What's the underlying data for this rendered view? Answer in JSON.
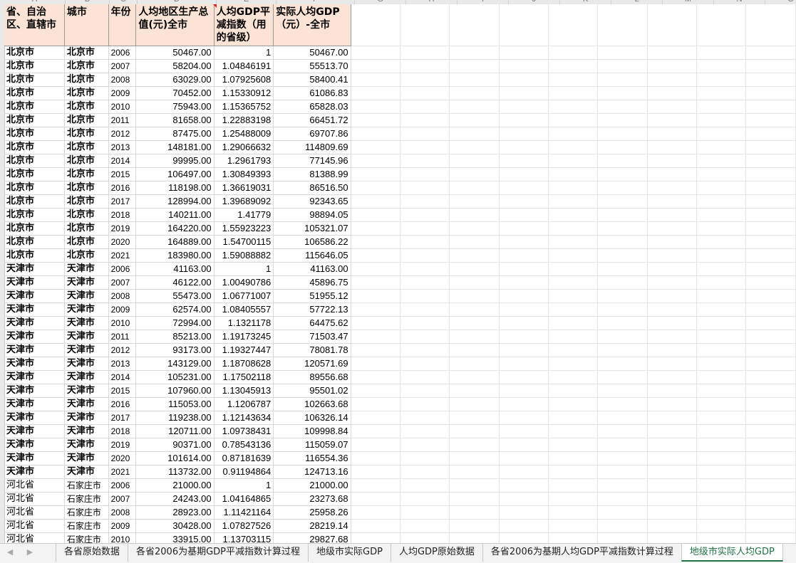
{
  "column_letters": [
    "A",
    "B",
    "C",
    "D",
    "E",
    "F",
    "G",
    "H",
    "I",
    "J",
    "K",
    "L",
    "M",
    "N",
    "O"
  ],
  "headers": {
    "province": "省、自治区、直辖市",
    "city": "城市",
    "year": "年份",
    "gdp_per_capita": "人均地区生产总值(元)全市",
    "deflator": "人均GDP平减指数（用的省级）",
    "real_gdp": "实际人均GDP（元）-全市"
  },
  "rows": [
    {
      "province": "北京市",
      "city": "北京市",
      "year": "2006",
      "gdp": "50467.00",
      "deflator": "1",
      "real": "50467.00"
    },
    {
      "province": "北京市",
      "city": "北京市",
      "year": "2007",
      "gdp": "58204.00",
      "deflator": "1.04846191",
      "real": "55513.70"
    },
    {
      "province": "北京市",
      "city": "北京市",
      "year": "2008",
      "gdp": "63029.00",
      "deflator": "1.07925608",
      "real": "58400.41"
    },
    {
      "province": "北京市",
      "city": "北京市",
      "year": "2009",
      "gdp": "70452.00",
      "deflator": "1.15330912",
      "real": "61086.83"
    },
    {
      "province": "北京市",
      "city": "北京市",
      "year": "2010",
      "gdp": "75943.00",
      "deflator": "1.15365752",
      "real": "65828.03"
    },
    {
      "province": "北京市",
      "city": "北京市",
      "year": "2011",
      "gdp": "81658.00",
      "deflator": "1.22883198",
      "real": "66451.72"
    },
    {
      "province": "北京市",
      "city": "北京市",
      "year": "2012",
      "gdp": "87475.00",
      "deflator": "1.25488009",
      "real": "69707.86"
    },
    {
      "province": "北京市",
      "city": "北京市",
      "year": "2013",
      "gdp": "148181.00",
      "deflator": "1.29066632",
      "real": "114809.69"
    },
    {
      "province": "北京市",
      "city": "北京市",
      "year": "2014",
      "gdp": "99995.00",
      "deflator": "1.2961793",
      "real": "77145.96"
    },
    {
      "province": "北京市",
      "city": "北京市",
      "year": "2015",
      "gdp": "106497.00",
      "deflator": "1.30849393",
      "real": "81388.99"
    },
    {
      "province": "北京市",
      "city": "北京市",
      "year": "2016",
      "gdp": "118198.00",
      "deflator": "1.36619031",
      "real": "86516.50"
    },
    {
      "province": "北京市",
      "city": "北京市",
      "year": "2017",
      "gdp": "128994.00",
      "deflator": "1.39689092",
      "real": "92343.65"
    },
    {
      "province": "北京市",
      "city": "北京市",
      "year": "2018",
      "gdp": "140211.00",
      "deflator": "1.41779",
      "real": "98894.05"
    },
    {
      "province": "北京市",
      "city": "北京市",
      "year": "2019",
      "gdp": "164220.00",
      "deflator": "1.55923223",
      "real": "105321.07"
    },
    {
      "province": "北京市",
      "city": "北京市",
      "year": "2020",
      "gdp": "164889.00",
      "deflator": "1.54700115",
      "real": "106586.22"
    },
    {
      "province": "北京市",
      "city": "北京市",
      "year": "2021",
      "gdp": "183980.00",
      "deflator": "1.59088882",
      "real": "115646.05"
    },
    {
      "province": "天津市",
      "city": "天津市",
      "year": "2006",
      "gdp": "41163.00",
      "deflator": "1",
      "real": "41163.00"
    },
    {
      "province": "天津市",
      "city": "天津市",
      "year": "2007",
      "gdp": "46122.00",
      "deflator": "1.00490786",
      "real": "45896.75"
    },
    {
      "province": "天津市",
      "city": "天津市",
      "year": "2008",
      "gdp": "55473.00",
      "deflator": "1.06771007",
      "real": "51955.12"
    },
    {
      "province": "天津市",
      "city": "天津市",
      "year": "2009",
      "gdp": "62574.00",
      "deflator": "1.08405557",
      "real": "57722.13"
    },
    {
      "province": "天津市",
      "city": "天津市",
      "year": "2010",
      "gdp": "72994.00",
      "deflator": "1.1321178",
      "real": "64475.62"
    },
    {
      "province": "天津市",
      "city": "天津市",
      "year": "2011",
      "gdp": "85213.00",
      "deflator": "1.19173245",
      "real": "71503.47"
    },
    {
      "province": "天津市",
      "city": "天津市",
      "year": "2012",
      "gdp": "93173.00",
      "deflator": "1.19327447",
      "real": "78081.78"
    },
    {
      "province": "天津市",
      "city": "天津市",
      "year": "2013",
      "gdp": "143129.00",
      "deflator": "1.18708628",
      "real": "120571.69"
    },
    {
      "province": "天津市",
      "city": "天津市",
      "year": "2014",
      "gdp": "105231.00",
      "deflator": "1.17502118",
      "real": "89556.68"
    },
    {
      "province": "天津市",
      "city": "天津市",
      "year": "2015",
      "gdp": "107960.00",
      "deflator": "1.13045913",
      "real": "95501.02"
    },
    {
      "province": "天津市",
      "city": "天津市",
      "year": "2016",
      "gdp": "115053.00",
      "deflator": "1.1206787",
      "real": "102663.68"
    },
    {
      "province": "天津市",
      "city": "天津市",
      "year": "2017",
      "gdp": "119238.00",
      "deflator": "1.12143634",
      "real": "106326.14"
    },
    {
      "province": "天津市",
      "city": "天津市",
      "year": "2018",
      "gdp": "120711.00",
      "deflator": "1.09738431",
      "real": "109998.84"
    },
    {
      "province": "天津市",
      "city": "天津市",
      "year": "2019",
      "gdp": "90371.00",
      "deflator": "0.78543136",
      "real": "115059.07"
    },
    {
      "province": "天津市",
      "city": "天津市",
      "year": "2020",
      "gdp": "101614.00",
      "deflator": "0.87181639",
      "real": "116554.36"
    },
    {
      "province": "天津市",
      "city": "天津市",
      "year": "2021",
      "gdp": "113732.00",
      "deflator": "0.91194864",
      "real": "124713.16"
    },
    {
      "province": "河北省",
      "city": "石家庄市",
      "year": "2006",
      "gdp": "21000.00",
      "deflator": "1",
      "real": "21000.00"
    },
    {
      "province": "河北省",
      "city": "石家庄市",
      "year": "2007",
      "gdp": "24243.00",
      "deflator": "1.04164865",
      "real": "23273.68"
    },
    {
      "province": "河北省",
      "city": "石家庄市",
      "year": "2008",
      "gdp": "28923.00",
      "deflator": "1.11421164",
      "real": "25958.26"
    },
    {
      "province": "河北省",
      "city": "石家庄市",
      "year": "2009",
      "gdp": "30428.00",
      "deflator": "1.07827526",
      "real": "28219.14"
    },
    {
      "province": "河北省",
      "city": "石家庄市",
      "year": "2010",
      "gdp": "33915.00",
      "deflator": "1.13703115",
      "real": "29827.68"
    }
  ],
  "sheet_nav": {
    "prev": "◀",
    "next": "▶"
  },
  "sheet_tabs": [
    {
      "label": "各省原始数据",
      "active": false
    },
    {
      "label": "各省2006为基期GDP平减指数计算过程",
      "active": false
    },
    {
      "label": "地级市实际GDP",
      "active": false
    },
    {
      "label": "人均GDP原始数据",
      "active": false
    },
    {
      "label": "各省2006为基期人均GDP平减指数计算过程",
      "active": false
    },
    {
      "label": "地级市实际人均GDP",
      "active": true
    }
  ]
}
